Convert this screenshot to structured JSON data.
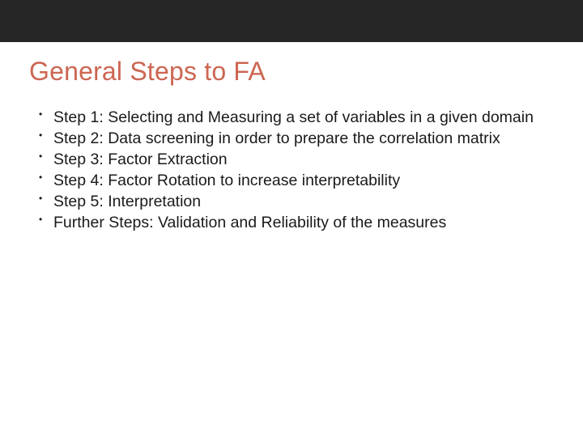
{
  "title": "General Steps to FA",
  "bullets": [
    "Step 1: Selecting and Measuring a set of variables in a given domain",
    "Step 2: Data screening in order to prepare the correlation matrix",
    "Step 3: Factor Extraction",
    "Step 4: Factor Rotation to increase interpretability",
    "Step 5: Interpretation",
    "Further Steps: Validation and Reliability of the measures"
  ]
}
